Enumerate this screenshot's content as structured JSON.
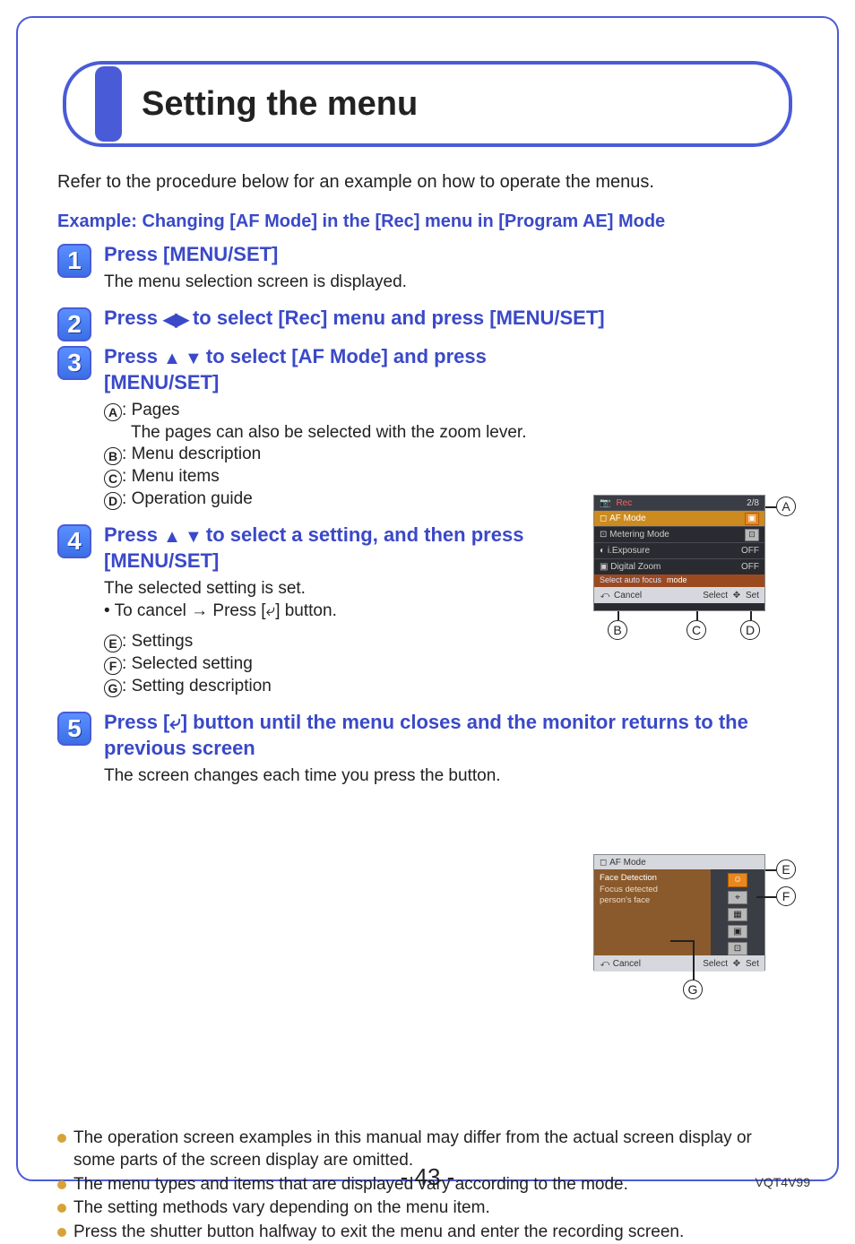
{
  "page": {
    "title": "Setting the menu",
    "intro": "Refer to the procedure below for an example on how to operate the menus.",
    "example_heading": "Example: Changing [AF Mode] in the [Rec] menu in [Program AE] Mode",
    "page_number": "- 43 -",
    "doc_code": "VQT4V99"
  },
  "steps": {
    "s1": {
      "num": "1",
      "title": "Press [MENU/SET]",
      "body": "The menu selection screen is displayed."
    },
    "s2": {
      "num": "2",
      "title_pre": "Press ",
      "title_post": " to select [Rec] menu and press [MENU/SET]"
    },
    "s3": {
      "num": "3",
      "title_pre": "Press ",
      "title_mid": " to select [AF Mode] and press ",
      "title_post": "[MENU/SET]",
      "a_label": "Pages",
      "a_sub": "The pages can also be selected with the zoom lever.",
      "b_label": "Menu description",
      "c_label": "Menu items",
      "d_label": "Operation guide"
    },
    "s4": {
      "num": "4",
      "title_pre": "Press ",
      "title_mid": " to select a setting, and then press ",
      "title_post": "[MENU/SET]",
      "body1": "The selected setting is set.",
      "body2_pre": " • To cancel → Press [",
      "body2_post": "] button.",
      "e_label": "Settings",
      "f_label": "Selected setting",
      "g_label": "Setting description"
    },
    "s5": {
      "num": "5",
      "title_pre": "Press [",
      "title_post": "] button until the menu closes and the monitor returns to the previous screen",
      "body": "The screen changes each time you press the button."
    }
  },
  "notes": {
    "n1": "The operation screen examples in this manual may differ from the actual screen display or some parts of the screen display are omitted.",
    "n2": "The menu types and items that are displayed vary according to the mode.",
    "n3": "The setting methods vary depending on the menu item.",
    "n4": "Press the shutter button halfway to exit the menu and enter the recording screen."
  },
  "labels": {
    "A": "A",
    "B": "B",
    "C": "C",
    "D": "D",
    "E": "E",
    "F": "F",
    "G": "G"
  },
  "fig1": {
    "tab": "Rec",
    "page_indicator": "2/8",
    "row_sel": "AF Mode",
    "row_sel_icon": "▣",
    "row2": "Metering Mode",
    "row2_icon": "⊡",
    "row3": "i.Exposure",
    "row3_val": "OFF",
    "row4": "Digital Zoom",
    "row4_val": "OFF",
    "help_left": "Select auto focus",
    "help_right": "mode",
    "bar_cancel": "Cancel",
    "bar_select": "Select",
    "bar_set": "Set"
  },
  "fig2": {
    "tab": "AF Mode",
    "left_line1": "Face Detection",
    "left_line2": "Focus detected",
    "left_line3": "person's face",
    "opt_face_icon": "☺",
    "bar_cancel": "Cancel",
    "bar_select": "Select",
    "bar_set": "Set"
  }
}
